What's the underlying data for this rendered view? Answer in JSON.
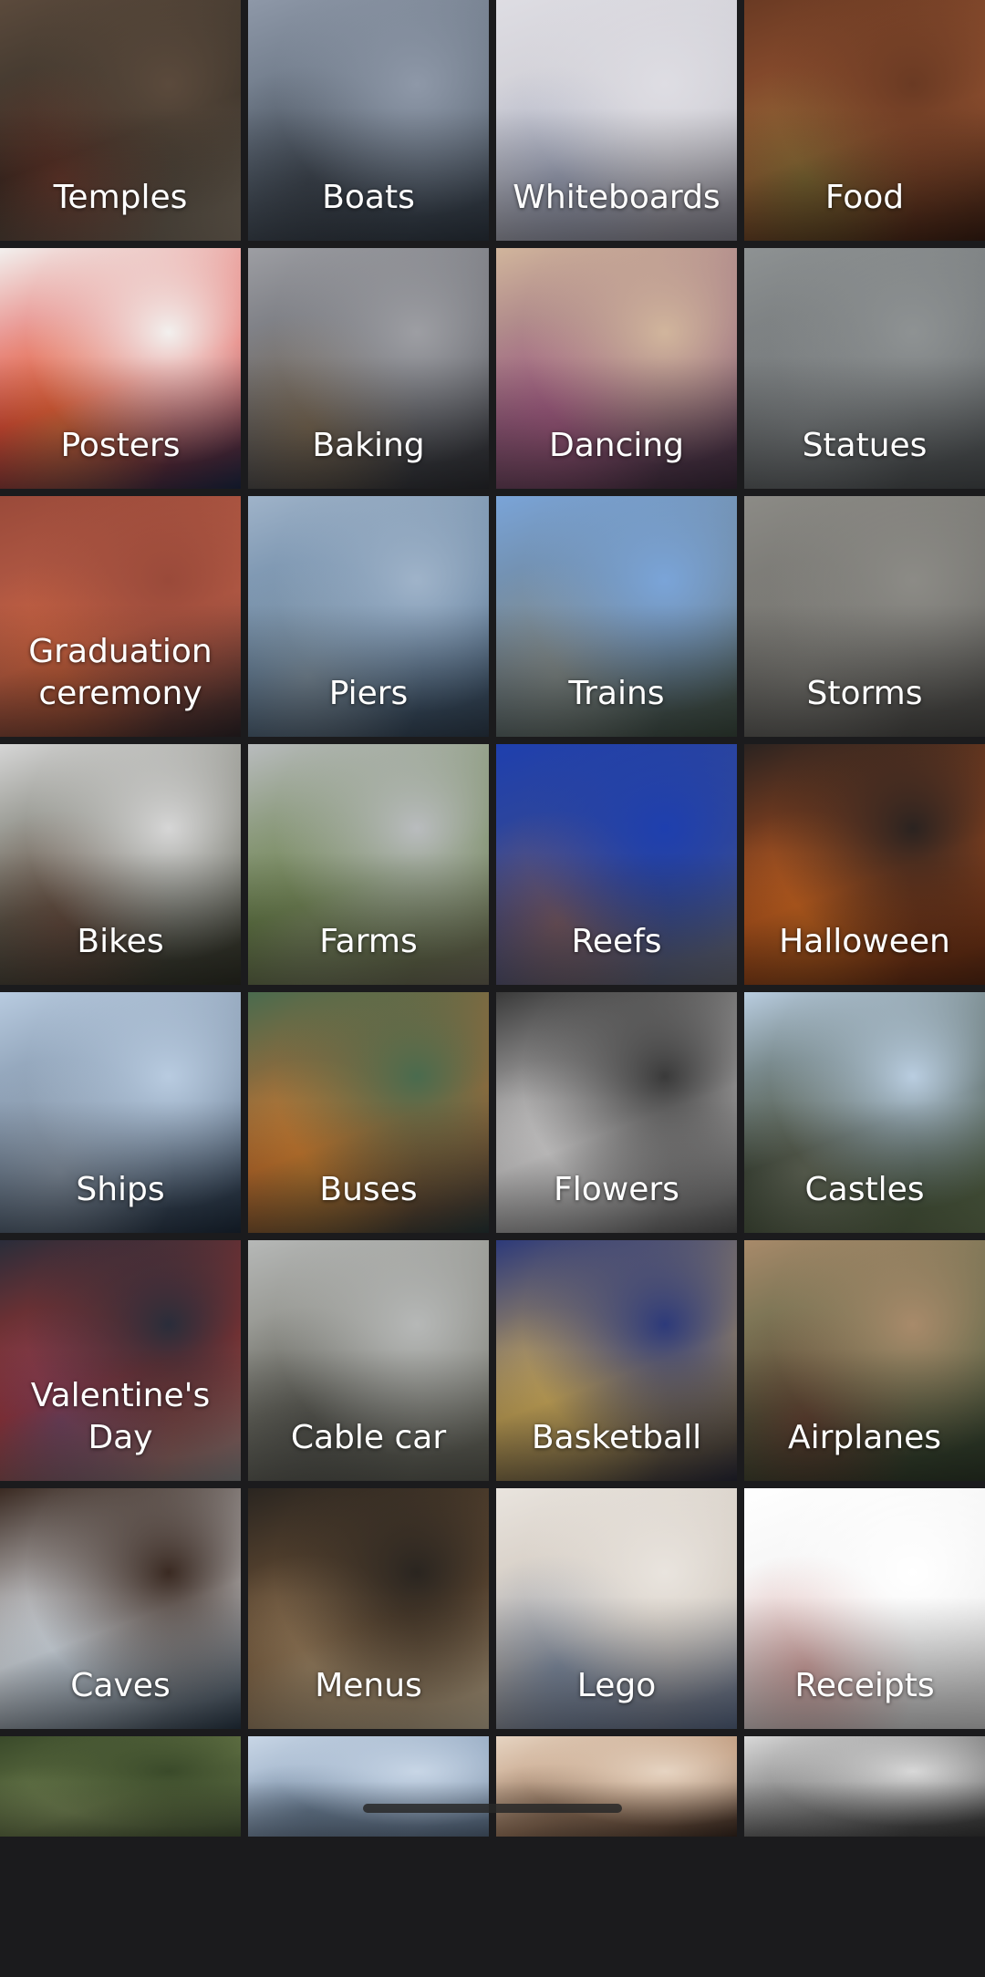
{
  "categories": [
    {
      "label": "Temples",
      "colors": [
        "#5b4a3c",
        "#2f2b24",
        "#8b7d6c"
      ],
      "accent": "#c7452f"
    },
    {
      "label": "Boats",
      "colors": [
        "#8e98a8",
        "#5a6674",
        "#2f3843"
      ],
      "accent": "#1e1e22"
    },
    {
      "label": "Whiteboards",
      "colors": [
        "#dedde3",
        "#c9c8cf",
        "#8a8894"
      ],
      "accent": "#6b7fb0"
    },
    {
      "label": "Food",
      "colors": [
        "#6a3a23",
        "#a15a35",
        "#3d2014"
      ],
      "accent": "#5e9c3d"
    },
    {
      "label": "Posters",
      "colors": [
        "#f2f0ee",
        "#e03b34",
        "#1d2a49"
      ],
      "accent": "#f0c64a"
    },
    {
      "label": "Baking",
      "colors": [
        "#9d9ea3",
        "#5d5f66",
        "#2d2e33"
      ],
      "accent": "#c69044"
    },
    {
      "label": "Dancing",
      "colors": [
        "#d1b59c",
        "#8a5a77",
        "#3b2b3c"
      ],
      "accent": "#e06aa0"
    },
    {
      "label": "Statues",
      "colors": [
        "#8e9293",
        "#6c7072",
        "#4b4f51"
      ],
      "accent": "#a2a6a8"
    },
    {
      "label": "Graduation\nceremony",
      "colors": [
        "#9a4a3a",
        "#c0624a",
        "#30262a"
      ],
      "accent": "#ee6b2a"
    },
    {
      "label": "Piers",
      "colors": [
        "#9fb3c9",
        "#5b7a99",
        "#2f3e4e"
      ],
      "accent": "#d8d4c8"
    },
    {
      "label": "Trains",
      "colors": [
        "#7aa4d8",
        "#6b7c86",
        "#3b4a3e"
      ],
      "accent": "#c9c2b0"
    },
    {
      "label": "Storms",
      "colors": [
        "#8c8b86",
        "#6d6c68",
        "#4a4946"
      ],
      "accent": "#a19f98"
    },
    {
      "label": "Bikes",
      "colors": [
        "#d6d6d6",
        "#5b5d4f",
        "#2f3026"
      ],
      "accent": "#8a3b2f"
    },
    {
      "label": "Farms",
      "colors": [
        "#b9bcbe",
        "#607a3f",
        "#6f6a5a"
      ],
      "accent": "#a7a897"
    },
    {
      "label": "Reefs",
      "colors": [
        "#1e3fae",
        "#3b4b8a",
        "#6b6e7a"
      ],
      "accent": "#f07a2a"
    },
    {
      "label": "Halloween",
      "colors": [
        "#2b2320",
        "#b4501e",
        "#5a2a14"
      ],
      "accent": "#ff9a2a"
    },
    {
      "label": "Ships",
      "colors": [
        "#b8cbe0",
        "#6b7e94",
        "#1e2c3d"
      ],
      "accent": "#e9eef5"
    },
    {
      "label": "Buses",
      "colors": [
        "#4a6b4e",
        "#c46a2f",
        "#2a3a3b"
      ],
      "accent": "#e6b33a"
    },
    {
      "label": "Flowers",
      "colors": [
        "#3a3a3a",
        "#d8d6d6",
        "#5a5a5a"
      ],
      "accent": "#efefef"
    },
    {
      "label": "Castles",
      "colors": [
        "#b9cde0",
        "#2d3a2a",
        "#6a7b56"
      ],
      "accent": "#d8d0c2"
    },
    {
      "label": "Valentine's\nDay",
      "colors": [
        "#2a2d3a",
        "#b8352c",
        "#8a8a8a"
      ],
      "accent": "#1c5ec8"
    },
    {
      "label": "Cable car",
      "colors": [
        "#b6b8b7",
        "#7a7a70",
        "#5d5e55"
      ],
      "accent": "#2a2a2a"
    },
    {
      "label": "Basketball",
      "colors": [
        "#2d3a7a",
        "#caa85a",
        "#2a2a3a"
      ],
      "accent": "#e5c26a"
    },
    {
      "label": "Airplanes",
      "colors": [
        "#a88a6a",
        "#4c5e3f",
        "#2f3a2a"
      ],
      "accent": "#a8222a"
    },
    {
      "label": "Caves",
      "colors": [
        "#3a2a22",
        "#eef2f6",
        "#2a3a4a"
      ],
      "accent": "#b0c4d8"
    },
    {
      "label": "Menus",
      "colors": [
        "#2a2520",
        "#7a5a3a",
        "#c8b89a"
      ],
      "accent": "#e8d6b0"
    },
    {
      "label": "Lego",
      "colors": [
        "#e9e4de",
        "#c9bfb4",
        "#5a6b8a"
      ],
      "accent": "#2a5ea8"
    },
    {
      "label": "Receipts",
      "colors": [
        "#ffffff",
        "#eeeeee",
        "#d8d8d8"
      ],
      "accent": "#c2332a"
    },
    {
      "label": "",
      "colors": [
        "#3a4a2a",
        "#6a7a4a",
        "#4a5a3a"
      ],
      "accent": "#8a9a6a"
    },
    {
      "label": "",
      "colors": [
        "#c8d6e6",
        "#8aa0ba",
        "#5a6e86"
      ],
      "accent": "#2a3a4a"
    },
    {
      "label": "",
      "colors": [
        "#e6d4c2",
        "#b48a6a",
        "#3a2a22"
      ],
      "accent": "#2a2a2a"
    },
    {
      "label": "",
      "colors": [
        "#d8d8d8",
        "#6a6a6a",
        "#3a3a3a"
      ],
      "accent": "#9a9a9a"
    }
  ]
}
